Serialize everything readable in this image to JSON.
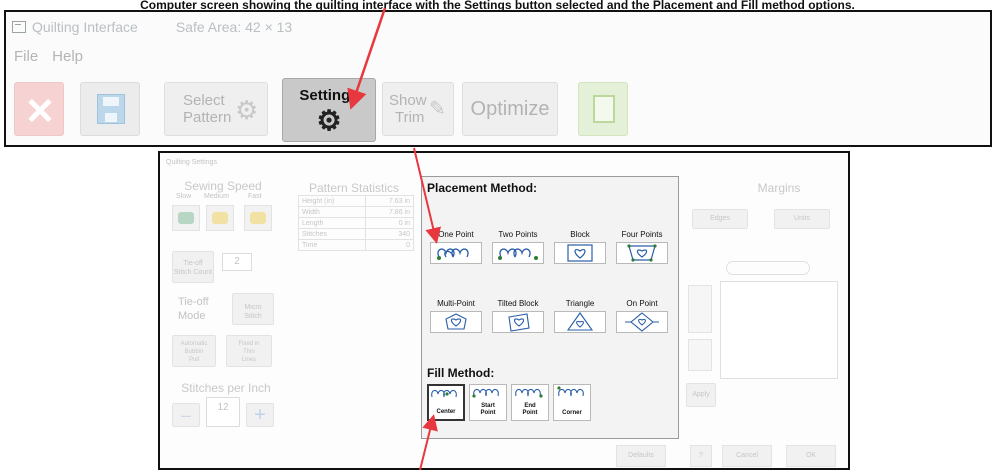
{
  "caption": "Computer screen showing the quilting interface with the Settings button selected and the Placement and Fill method options.",
  "app": {
    "title": "Quilting Interface",
    "safe_area": "Safe Area: 42 × 13",
    "menu": [
      "File",
      "Help"
    ],
    "toolbar": {
      "select_pattern_line1": "Select",
      "select_pattern_line2": "Pattern",
      "settings_label": "Settings",
      "show_trim_line1": "Show",
      "show_trim_line2": "Trim",
      "optimize_label": "Optimize"
    }
  },
  "dialog": {
    "title": "Quilting Settings",
    "sewing_speed": {
      "title": "Sewing Speed",
      "labels": [
        "Slow",
        "Medium",
        "Fast"
      ],
      "tie_off_stitch_count_line1": "Tie-off",
      "tie_off_stitch_count_line2": "Stitch Count",
      "tie_off_stitch_count_value": "2",
      "tie_off_mode_line1": "Tie-off",
      "tie_off_mode_line2": "Mode",
      "micro_stitch_line1": "Micro",
      "micro_stitch_line2": "Stitch",
      "btn3_line1": "Automatic",
      "btn3_line2": "Bobbin",
      "btn3_line3": "Pull",
      "btn4_line1": "Fixed in",
      "btn4_line2": "Thin",
      "btn4_line3": "Lines",
      "stitches_per_inch_title": "Stitches per Inch",
      "stitches_per_inch_value": "12",
      "minus": "–",
      "plus": "+"
    },
    "pattern_statistics": {
      "title": "Pattern Statistics",
      "rows": [
        {
          "label": "Height (in)",
          "value": "7.63 in"
        },
        {
          "label": "Width",
          "value": "7.86 in"
        },
        {
          "label": "Length",
          "value": "0 in"
        },
        {
          "label": "Stitches",
          "value": "340"
        },
        {
          "label": "Time",
          "value": "0"
        }
      ]
    },
    "placement_method": {
      "title": "Placement Method:",
      "options": [
        "One Point",
        "Two Points",
        "Block",
        "Four Points",
        "Multi-Point",
        "Tilted Block",
        "Triangle",
        "On Point"
      ]
    },
    "fill_method": {
      "title": "Fill Method:",
      "options": [
        {
          "line1": "",
          "line2": "Center"
        },
        {
          "line1": "Start",
          "line2": "Point"
        },
        {
          "line1": "End",
          "line2": "Point"
        },
        {
          "line1": "",
          "line2": "Corner"
        }
      ],
      "selected": "Center"
    },
    "margins": {
      "title": "Margins",
      "buttons": [
        "Edges",
        "Units"
      ],
      "apply_label": "Apply"
    },
    "footer": {
      "defaults_label": "Defaults",
      "cancel_label": "Cancel",
      "ok_label": "OK"
    }
  },
  "colors": {
    "arrow": "#e8383f",
    "accent_blue": "#2a5da8",
    "faded_text": "#c3c3c3"
  }
}
